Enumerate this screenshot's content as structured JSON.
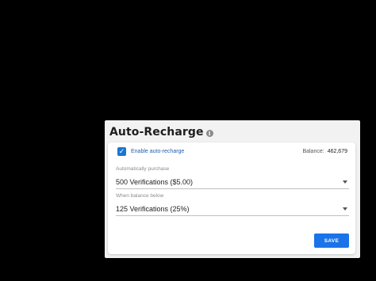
{
  "auto_recharge": {
    "title": "Auto-Recharge",
    "info_glyph": "i",
    "enable_checkbox": {
      "checked": true,
      "check_glyph": "✓",
      "label": "Enable auto-recharge"
    },
    "balance": {
      "label": "Balance:",
      "value": "462,679"
    },
    "purchase_field": {
      "label": "Automatically purchase",
      "value": "500 Verifications ($5.00)"
    },
    "threshold_field": {
      "label": "When balance below",
      "value": "125 Verifications (25%)"
    },
    "save_label": "SAVE"
  },
  "colors": {
    "background": "#000000",
    "panel": "#f2f2f2",
    "card": "#ffffff",
    "accent": "#1a73e8",
    "checkbox": "#1976d2"
  }
}
